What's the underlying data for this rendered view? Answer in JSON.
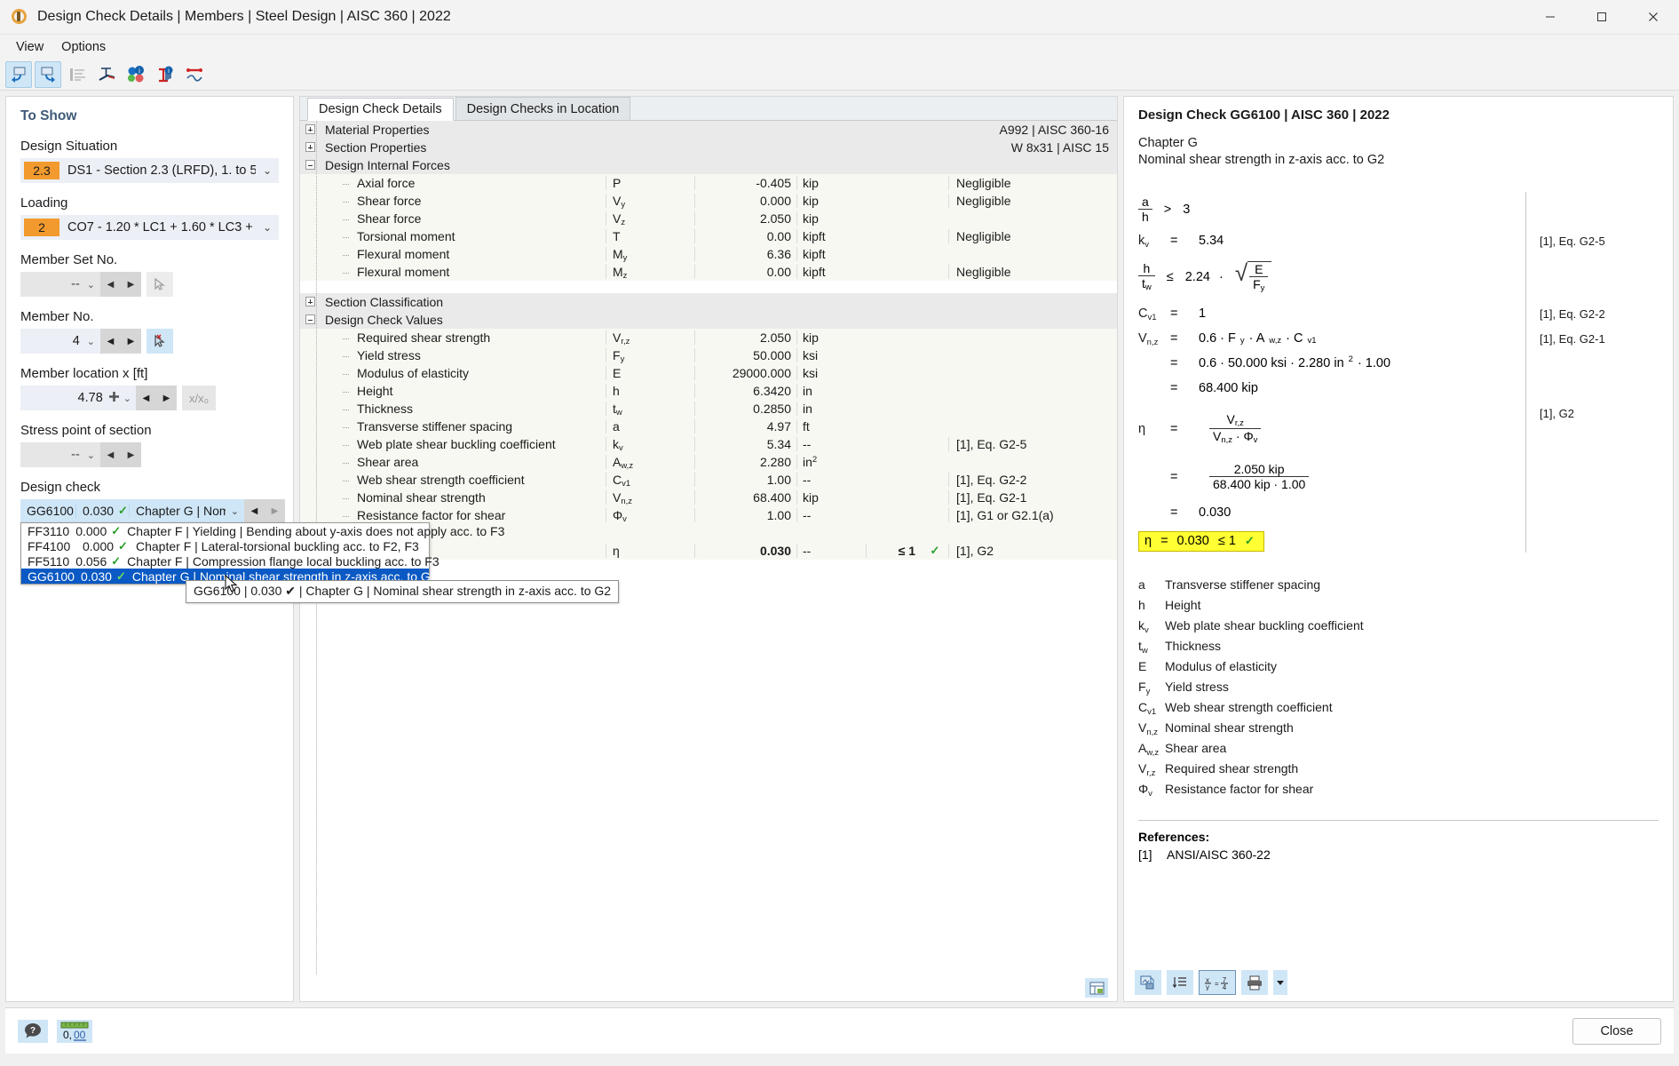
{
  "window": {
    "title": "Design Check Details | Members | Steel Design | AISC 360 | 2022",
    "app_icon": "rfem-logo-icon",
    "minimize": "minimize-icon",
    "maximize": "maximize-icon",
    "close": "close-icon"
  },
  "menubar": {
    "items": [
      "View",
      "Options"
    ]
  },
  "toolbar": {
    "buttons": [
      "previous-view-icon",
      "next-view-icon",
      "detail-list-icon",
      "cross-section-icon",
      "info-colors-icon",
      "info-member-icon",
      "diagram-icon"
    ]
  },
  "sidebar": {
    "title": "To Show",
    "design_situation": {
      "label": "Design Situation",
      "tag": "2.3",
      "value": "DS1 - Section 2.3 (LRFD), 1. to 5."
    },
    "loading": {
      "label": "Loading",
      "tag": "2",
      "value": "CO7 - 1.20 * LC1 + 1.60 * LC3 + ..."
    },
    "member_set": {
      "label": "Member Set No.",
      "value": "--"
    },
    "member_no": {
      "label": "Member No.",
      "value": "4"
    },
    "member_location": {
      "label": "Member location x [ft]",
      "value": "4.78",
      "ratio_button": "x/x₀"
    },
    "stress_point": {
      "label": "Stress point of section",
      "value": "--"
    },
    "design_check": {
      "label": "Design check",
      "selected": {
        "id": "GG6100",
        "ratio": "0.030",
        "text": "Chapter G | Nomi..."
      },
      "options": [
        {
          "id": "FF3110",
          "ratio": "0.000",
          "text": "Chapter F | Yielding | Bending about y-axis does not apply acc. to F3",
          "selected": false
        },
        {
          "id": "FF4100",
          "ratio": "0.000",
          "text": "Chapter F | Lateral-torsional buckling acc. to F2, F3",
          "selected": false
        },
        {
          "id": "FF5110",
          "ratio": "0.056",
          "text": "Chapter F | Compression flange local buckling acc. to F3",
          "selected": false
        },
        {
          "id": "GG6100",
          "ratio": "0.030",
          "text": "Chapter G | Nominal shear strength in z-axis acc. to G2",
          "selected": true
        }
      ],
      "tooltip": "GG6100 | 0.030 ✔ | Chapter G | Nominal shear strength in z-axis acc. to G2"
    }
  },
  "center": {
    "tabs": [
      {
        "label": "Design Check Details",
        "active": true
      },
      {
        "label": "Design Checks in Location",
        "active": false
      }
    ],
    "groups": [
      {
        "name": "Material Properties",
        "expanded": false,
        "right": "A992 | AISC 360-16"
      },
      {
        "name": "Section Properties",
        "expanded": false,
        "right": "W 8x31 | AISC 15"
      },
      {
        "name": "Design Internal Forces",
        "expanded": true,
        "right": ""
      }
    ],
    "internal_forces": [
      {
        "name": "Axial force",
        "sym": "P",
        "sub": "",
        "value": "-0.405",
        "unit": "kip",
        "note": "Negligible"
      },
      {
        "name": "Shear force",
        "sym": "V",
        "sub": "y",
        "value": "0.000",
        "unit": "kip",
        "note": "Negligible"
      },
      {
        "name": "Shear force",
        "sym": "V",
        "sub": "z",
        "value": "2.050",
        "unit": "kip",
        "note": ""
      },
      {
        "name": "Torsional moment",
        "sym": "T",
        "sub": "",
        "value": "0.00",
        "unit": "kipft",
        "note": "Negligible"
      },
      {
        "name": "Flexural moment",
        "sym": "M",
        "sub": "y",
        "value": "6.36",
        "unit": "kipft",
        "note": ""
      },
      {
        "name": "Flexural moment",
        "sym": "M",
        "sub": "z",
        "value": "0.00",
        "unit": "kipft",
        "note": "Negligible"
      }
    ],
    "section_classification": {
      "name": "Section Classification",
      "expanded": false
    },
    "design_check_values_group": {
      "name": "Design Check Values",
      "expanded": true
    },
    "design_check_values": [
      {
        "name": "Required shear strength",
        "sym": "V",
        "sub": "r,z",
        "value": "2.050",
        "unit": "kip",
        "unit_sup": "",
        "ref": ""
      },
      {
        "name": "Yield stress",
        "sym": "F",
        "sub": "y",
        "value": "50.000",
        "unit": "ksi",
        "unit_sup": "",
        "ref": ""
      },
      {
        "name": "Modulus of elasticity",
        "sym": "E",
        "sub": "",
        "value": "29000.000",
        "unit": "ksi",
        "unit_sup": "",
        "ref": ""
      },
      {
        "name": "Height",
        "sym": "h",
        "sub": "",
        "value": "6.3420",
        "unit": "in",
        "unit_sup": "",
        "ref": ""
      },
      {
        "name": "Thickness",
        "sym": "t",
        "sub": "w",
        "value": "0.2850",
        "unit": "in",
        "unit_sup": "",
        "ref": ""
      },
      {
        "name": "Transverse stiffener spacing",
        "sym": "a",
        "sub": "",
        "value": "4.97",
        "unit": "ft",
        "unit_sup": "",
        "ref": ""
      },
      {
        "name": "Web plate shear buckling coefficient",
        "sym": "k",
        "sub": "v",
        "value": "5.34",
        "unit": "--",
        "unit_sup": "",
        "ref": "[1], Eq. G2-5"
      },
      {
        "name": "Shear area",
        "sym": "A",
        "sub": "w,z",
        "value": "2.280",
        "unit": "in",
        "unit_sup": "2",
        "ref": ""
      },
      {
        "name": "Web shear strength coefficient",
        "sym": "C",
        "sub": "v1",
        "value": "1.00",
        "unit": "--",
        "unit_sup": "",
        "ref": "[1], Eq. G2-2"
      },
      {
        "name": "Nominal shear strength",
        "sym": "V",
        "sub": "n,z",
        "value": "68.400",
        "unit": "kip",
        "unit_sup": "",
        "ref": "[1], Eq. G2-1"
      },
      {
        "name": "Resistance factor for shear",
        "sym": "Φ",
        "sub": "v",
        "value": "1.00",
        "unit": "--",
        "unit_sup": "",
        "ref": "[1], G1 or G2.1(a)"
      }
    ],
    "result_row": {
      "sym": "η",
      "value": "0.030",
      "unit": "--",
      "limit": "≤ 1",
      "ok": "✓",
      "ref": "[1], G2"
    },
    "bottom_button": "table-settings-icon"
  },
  "right": {
    "title": "Design Check GG6100 | AISC 360 | 2022",
    "chapter": "Chapter G",
    "subtitle": "Nominal shear strength in z-axis acc. to G2",
    "formulas": [
      {
        "id": "f1",
        "ref": ""
      },
      {
        "id": "f2",
        "sym": "k",
        "sub": "v",
        "eq": "=",
        "value": "5.34",
        "ref": "[1], Eq. G2-5"
      },
      {
        "id": "f3",
        "ref": ""
      },
      {
        "id": "f4",
        "sym": "C",
        "sub": "v1",
        "eq": "=",
        "value": "1",
        "ref": "[1], Eq. G2-2"
      },
      {
        "id": "f5",
        "ref": "[1], Eq. G2-1"
      },
      {
        "id": "f6",
        "ref": "[1], G2"
      }
    ],
    "f1_text": {
      "num": "a",
      "den": "h",
      "op": ">",
      "rhs": "3"
    },
    "f3_text": {
      "num": "h",
      "den": "t",
      "den_sub": "w",
      "op": "≤",
      "coef": "2.24",
      "dot": "·",
      "sq_num": "E",
      "sq_den": "F",
      "sq_den_sub": "y"
    },
    "vnz": {
      "sym": "V",
      "sub": "n,z",
      "line1": "0.6  ·  F",
      "line1_sub": "y",
      "line1b": " ·  A",
      "line1b_sub": "w,z",
      "line1c": " ·  C",
      "line1c_sub": "v1",
      "line2": "0.6 · 50.000 ksi · 2.280 in",
      "line2_sup": "2",
      "line2b": " · 1.00",
      "line3": "68.400 kip"
    },
    "eta": {
      "sym": "η",
      "frac1_num": "V",
      "frac1_num_sub": "r,z",
      "frac1_den": "V",
      "frac1_den_sub": "n,z",
      "frac1_den_b": " · Φ",
      "frac1_den_b_sub": "v",
      "frac2_num": "2.050 kip",
      "frac2_den": "68.400 kip · 1.00",
      "result": "0.030",
      "highlight_value": "0.030",
      "highlight_limit": "≤ 1",
      "highlight_ok": "✓"
    },
    "legend": [
      {
        "sym": "a",
        "sub": "",
        "text": "Transverse stiffener spacing"
      },
      {
        "sym": "h",
        "sub": "",
        "text": "Height"
      },
      {
        "sym": "k",
        "sub": "v",
        "text": "Web plate shear buckling coefficient"
      },
      {
        "sym": "t",
        "sub": "w",
        "text": "Thickness"
      },
      {
        "sym": "E",
        "sub": "",
        "text": "Modulus of elasticity"
      },
      {
        "sym": "F",
        "sub": "y",
        "text": "Yield stress"
      },
      {
        "sym": "C",
        "sub": "v1",
        "text": "Web shear strength coefficient"
      },
      {
        "sym": "V",
        "sub": "n,z",
        "text": "Nominal shear strength"
      },
      {
        "sym": "A",
        "sub": "w,z",
        "text": "Shear area"
      },
      {
        "sym": "V",
        "sub": "r,z",
        "text": "Required shear strength"
      },
      {
        "sym": "Φ",
        "sub": "v",
        "text": "Resistance factor for shear"
      }
    ],
    "references_title": "References:",
    "references": [
      {
        "num": "[1]",
        "text": "ANSI/AISC 360-22"
      }
    ],
    "bottom_buttons": [
      "export-picture-icon",
      "list-order-icon",
      "formula-values-icon",
      "print-icon",
      "print-dropdown-icon"
    ]
  },
  "statusbar": {
    "help_button": "help-icon",
    "units_button": "units-icon",
    "units_label": "0,00",
    "close_label": "Close"
  },
  "colors": {
    "accent_orange": "#f29a2e",
    "selection_blue": "#0a59c4",
    "light_blue": "#cfe6f7",
    "highlight_yellow": "#ffff33",
    "check_green": "#2a9d2a",
    "panel_title": "#3f5a78"
  }
}
